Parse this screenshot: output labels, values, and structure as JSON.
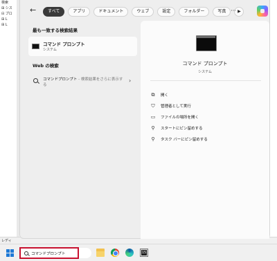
{
  "background": {
    "tree_items": [
      "検索",
      "⊞ シス",
      "⊟ プロ",
      "  ⊞ L",
      "  ⊞ L"
    ],
    "status": "レディ"
  },
  "topbar": {
    "tabs": [
      {
        "label": "すべて",
        "active": true
      },
      {
        "label": "アプリ",
        "active": false
      },
      {
        "label": "ドキュメント",
        "active": false
      },
      {
        "label": "ウェブ",
        "active": false
      },
      {
        "label": "設定",
        "active": false
      },
      {
        "label": "フォルダー",
        "active": false
      },
      {
        "label": "写真",
        "active": false
      }
    ],
    "play_label": "▶",
    "more_label": "···"
  },
  "left": {
    "best_match_title": "最も一致する検索結果",
    "best_match": {
      "name": "コマンド プロンプト",
      "type": "システム"
    },
    "web_title": "Web の検索",
    "web_query": "コマンドプロンプト",
    "web_hint": " - 検索結果をさらに表示する"
  },
  "right": {
    "name": "コマンド プロンプト",
    "type": "システム",
    "actions": [
      {
        "icon": "open-icon",
        "glyph": "⧉",
        "label": "開く"
      },
      {
        "icon": "admin-shield-icon",
        "glyph": "⛉",
        "label": "管理者として実行"
      },
      {
        "icon": "folder-open-icon",
        "glyph": "▭",
        "label": "ファイルの場所を開く"
      },
      {
        "icon": "pin-start-icon",
        "glyph": "⚲",
        "label": "スタートにピン留めする"
      },
      {
        "icon": "pin-taskbar-icon",
        "glyph": "⚲",
        "label": "タスク バーにピン留めする"
      }
    ]
  },
  "taskbar": {
    "search_value": "コマンドプロンプト"
  },
  "colors": {
    "accent_tab": "#3a3a3a",
    "search_highlight": "#c8102e",
    "windows_blue": "#1f7ad6"
  }
}
